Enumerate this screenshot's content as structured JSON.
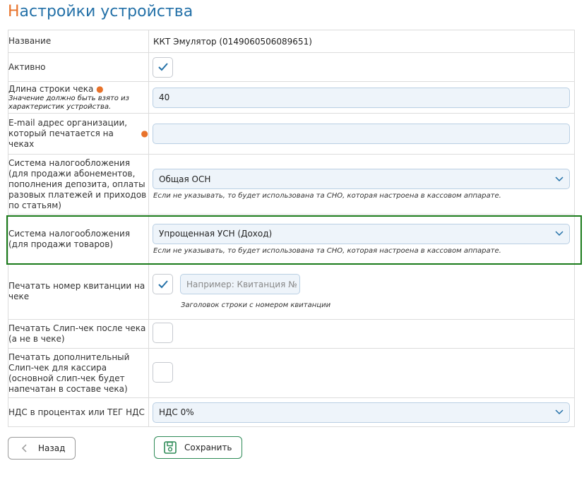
{
  "page": {
    "title_first_letter": "Н",
    "title_rest": "астройки устройства"
  },
  "rows": {
    "name": {
      "label": "Название",
      "value": "ККТ Эмулятор (014906050608965​1)"
    },
    "active": {
      "label": "Активно",
      "checked": true
    },
    "line_length": {
      "label": "Длина строки чека",
      "required_mark": "●",
      "hint": "Значение должно быть взято из характеристик устройства.",
      "value": "40"
    },
    "email": {
      "label": "E-mail адрес организации, который печатается на чеках",
      "required_mark": "●",
      "value": ""
    },
    "tax_system_services": {
      "label": "Система налогообложения (для продажи абонементов, пополнения депозита, оплаты разовых платежей и приходов по статьям)",
      "value": "Общая ОСН",
      "hint": "Если не указывать, то будет использована та СНО, которая настроена в кассовом аппарате."
    },
    "tax_system_goods": {
      "label": "Система налогообложения (для продажи товаров)",
      "value": "Упрощенная УСН (Доход)",
      "hint": "Если не указывать, то будет использована та СНО, которая настроена в кассовом аппарате."
    },
    "print_receipt_number": {
      "label": "Печатать номер квитанции на чеке",
      "checked": true,
      "placeholder": "Например: Квитанция №",
      "hint": "Заголовок строки с номером квитанции"
    },
    "print_slip": {
      "label": "Печатать Слип-чек после чека (а не в чеке)",
      "checked": false
    },
    "print_extra_slip": {
      "label": "Печатать дополнительный Слип-чек для кассира (основной слип-чек будет напечатан в составе чека)",
      "checked": false
    },
    "vat": {
      "label": "НДС в процентах или ТЕГ НДС",
      "value": "НДС 0%"
    }
  },
  "buttons": {
    "back": "Назад",
    "save": "Сохранить"
  },
  "colors": {
    "accent_blue": "#2471a8",
    "accent_orange": "#e8722a",
    "highlight_green": "#1a7a1a",
    "field_bg": "#eef4fa"
  }
}
